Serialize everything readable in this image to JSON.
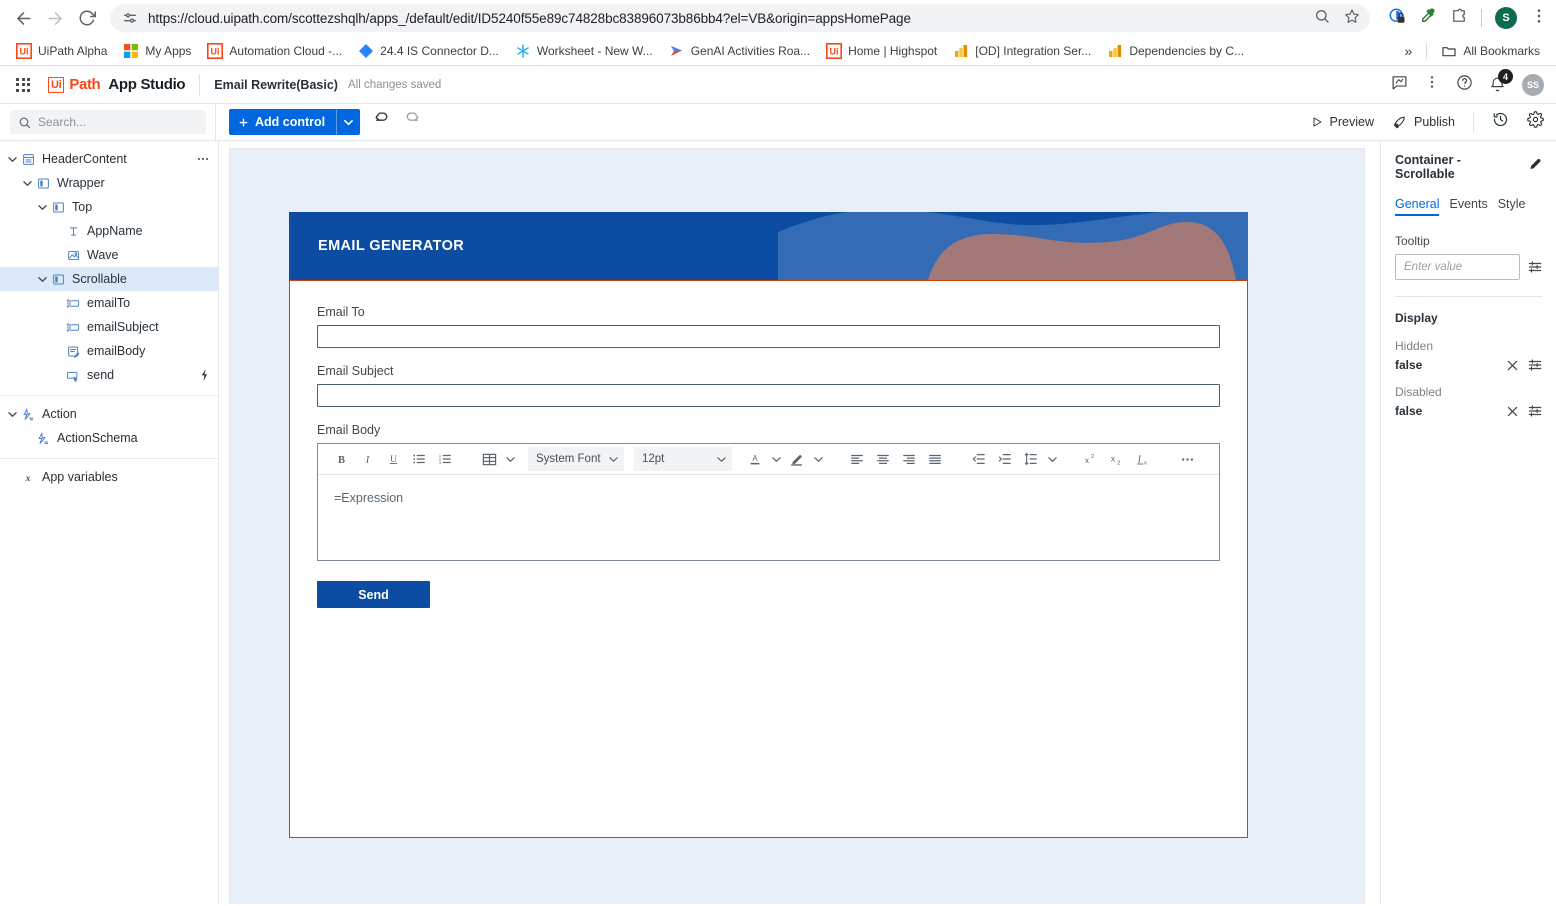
{
  "browser": {
    "url": "https://cloud.uipath.com/scottezshqlh/apps_/default/edit/ID5240f55e89c74828bc83896073b86bb4?el=VB&origin=appsHomePage",
    "bookmarks": [
      {
        "label": "UiPath Alpha",
        "icon": "uipath-icon"
      },
      {
        "label": "My Apps",
        "icon": "microsoft-icon"
      },
      {
        "label": "Automation Cloud -...",
        "icon": "uipath-icon"
      },
      {
        "label": "24.4 IS Connector D...",
        "icon": "jira-icon"
      },
      {
        "label": "Worksheet - New W...",
        "icon": "snowflake-icon"
      },
      {
        "label": "GenAI Activities Roa...",
        "icon": "arrow-icon"
      },
      {
        "label": "Home | Highspot",
        "icon": "uipath-icon"
      },
      {
        "label": "[OD] Integration Ser...",
        "icon": "chart-icon"
      },
      {
        "label": "Dependencies by C...",
        "icon": "chart-icon"
      }
    ],
    "overflow_label": "»",
    "all_bookmarks_label": "All Bookmarks",
    "profile_initial": "S"
  },
  "app_header": {
    "brand_ui": "Ui",
    "brand_path": "Path",
    "brand_product": "App Studio",
    "project_title": "Email Rewrite(Basic)",
    "save_state": "All changes saved",
    "notification_count": "4",
    "avatar_initials": "SS"
  },
  "toolbar": {
    "search_placeholder": "Search...",
    "add_control_label": "Add control",
    "preview_label": "Preview",
    "publish_label": "Publish"
  },
  "tree": {
    "groups": [
      {
        "items": [
          {
            "label": "HeaderContent",
            "icon": "page-icon",
            "depth": 0,
            "chevron": "down",
            "selected": false,
            "trailing": "more-dots"
          },
          {
            "label": "Wrapper",
            "icon": "container-icon",
            "depth": 1,
            "chevron": "down",
            "selected": false,
            "trailing": ""
          },
          {
            "label": "Top",
            "icon": "container-icon",
            "depth": 2,
            "chevron": "down",
            "selected": false,
            "trailing": ""
          },
          {
            "label": "AppName",
            "icon": "text-icon",
            "depth": 3,
            "chevron": "none",
            "selected": false,
            "trailing": ""
          },
          {
            "label": "Wave",
            "icon": "image-icon",
            "depth": 3,
            "chevron": "none",
            "selected": false,
            "trailing": ""
          },
          {
            "label": "Scrollable",
            "icon": "container-icon",
            "depth": 2,
            "chevron": "down",
            "selected": true,
            "trailing": ""
          },
          {
            "label": "emailTo",
            "icon": "input-icon",
            "depth": 3,
            "chevron": "none",
            "selected": false,
            "trailing": ""
          },
          {
            "label": "emailSubject",
            "icon": "input-icon",
            "depth": 3,
            "chevron": "none",
            "selected": false,
            "trailing": ""
          },
          {
            "label": "emailBody",
            "icon": "richtext-icon",
            "depth": 3,
            "chevron": "none",
            "selected": false,
            "trailing": ""
          },
          {
            "label": "send",
            "icon": "button-icon",
            "depth": 3,
            "chevron": "none",
            "selected": false,
            "trailing": "bolt"
          }
        ]
      },
      {
        "items": [
          {
            "label": "Action",
            "icon": "action-icon",
            "depth": 0,
            "chevron": "down",
            "selected": false,
            "trailing": ""
          },
          {
            "label": "ActionSchema",
            "icon": "action-icon",
            "depth": 1,
            "chevron": "none",
            "selected": false,
            "trailing": ""
          }
        ]
      },
      {
        "items": [
          {
            "label": "App variables",
            "icon": "variable-icon",
            "depth": 0,
            "chevron": "none",
            "selected": false,
            "trailing": ""
          }
        ]
      }
    ]
  },
  "canvas": {
    "banner_title": "EMAIL GENERATOR",
    "fields": [
      {
        "label": "Email To",
        "value": ""
      },
      {
        "label": "Email Subject",
        "value": ""
      }
    ],
    "body_label": "Email Body",
    "rte": {
      "font_family": "System Font",
      "font_size": "12pt",
      "content": "=Expression"
    },
    "send_label": "Send",
    "colors": {
      "banner_blue": "#0c4ca3",
      "wave_mid_blue": "#336bb5",
      "wave_rose": "#ac7a74",
      "selection_orange": "#c9420d",
      "page_bg": "#e9eff8"
    }
  },
  "properties": {
    "title": "Container - Scrollable",
    "tabs": [
      {
        "label": "General",
        "active": true
      },
      {
        "label": "Events",
        "active": false
      },
      {
        "label": "Style",
        "active": false
      }
    ],
    "tooltip_label": "Tooltip",
    "tooltip_placeholder": "Enter value",
    "tooltip_value": "",
    "display_section": "Display",
    "hidden_label": "Hidden",
    "hidden_value": "false",
    "disabled_label": "Disabled",
    "disabled_value": "false"
  }
}
